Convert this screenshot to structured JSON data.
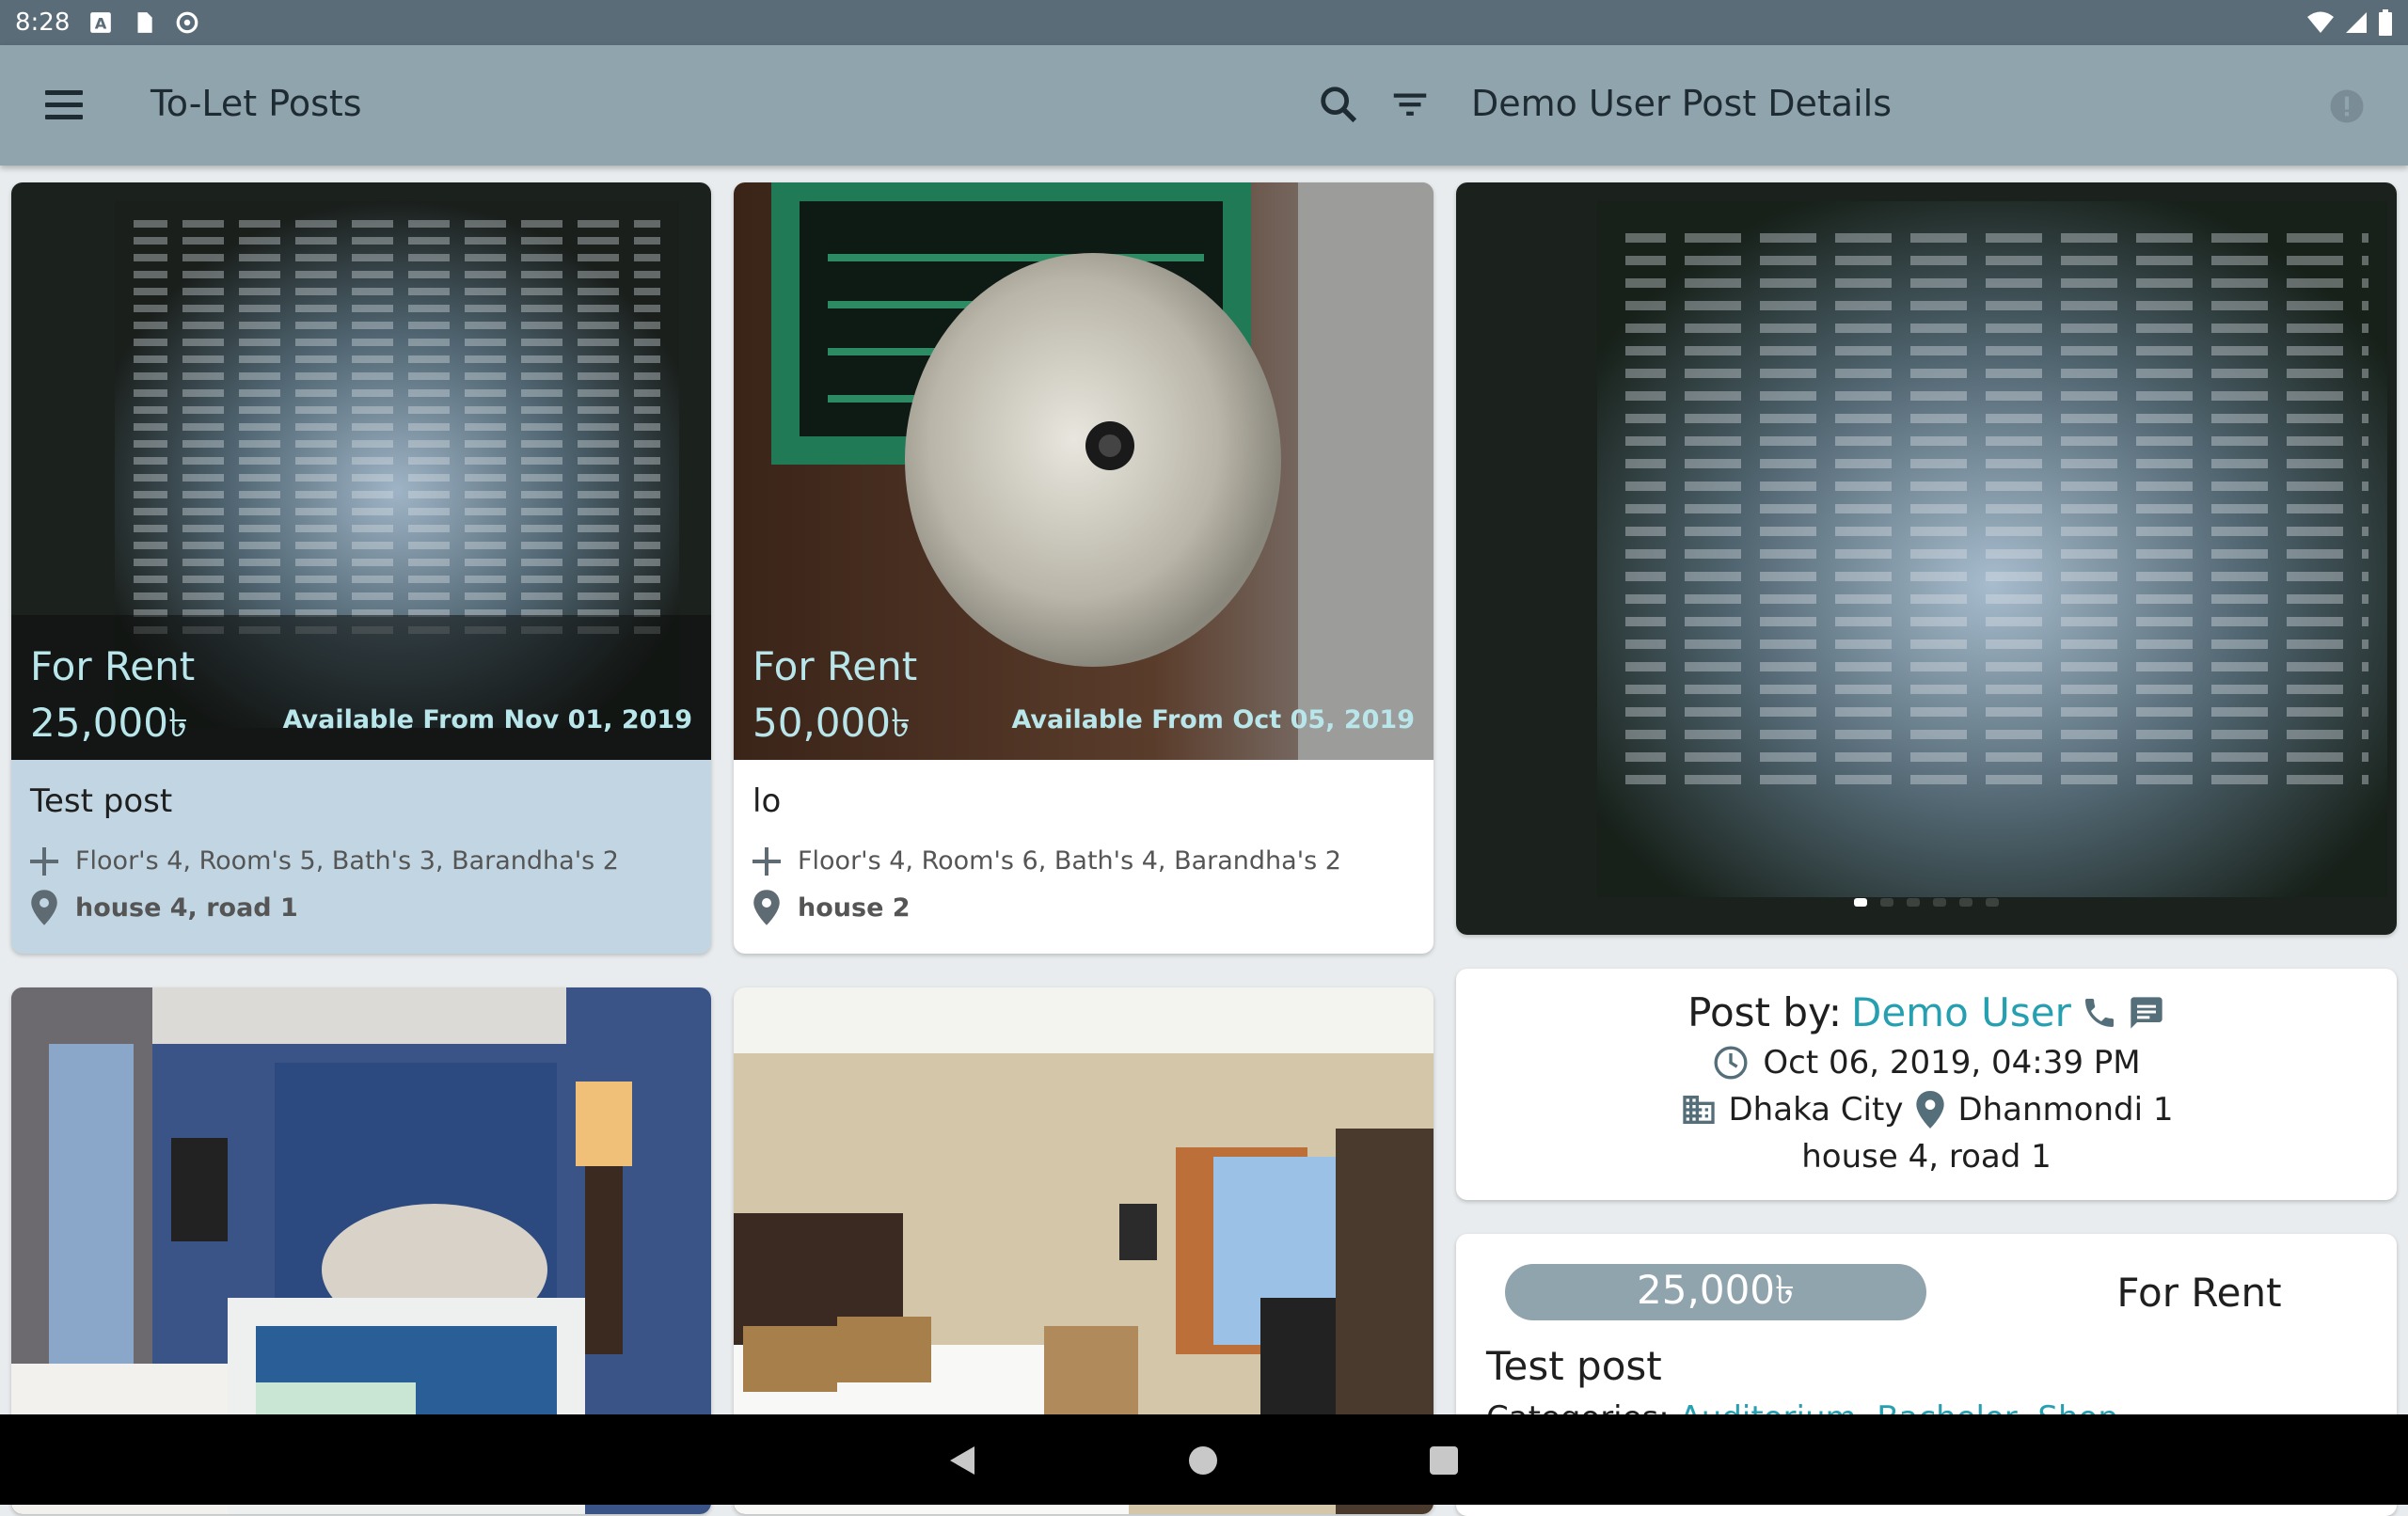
{
  "status_bar": {
    "time": "8:28"
  },
  "app_bar": {
    "title": "To-Let Posts",
    "detail_title": "Demo User Post Details"
  },
  "posts": [
    {
      "status": "For Rent",
      "price": "25,000৳",
      "available": "Available From Nov 01, 2019",
      "title": "Test post",
      "specs": "Floor's 4, Room's 5, Bath's 3, Barandha's 2",
      "address": "house 4, road 1"
    },
    {
      "status": "For Rent",
      "price": "50,000৳",
      "available": "Available From Oct 05, 2019",
      "title": "lo",
      "specs": "Floor's 4, Room's 6, Bath's 4, Barandha's 2",
      "address": "house 2"
    }
  ],
  "detail": {
    "post_by_label": "Post by:",
    "post_by_user": "Demo User",
    "datetime": "Oct 06, 2019, 04:39 PM",
    "city": "Dhaka City",
    "area": "Dhanmondi 1",
    "address": "house 4, road 1",
    "price": "25,000৳",
    "status": "For Rent",
    "title": "Test post",
    "categories_label": "Categories:",
    "categories_values": "Auditorium, Bachelor, Shop"
  },
  "colors": {
    "appbar": "#90a4ae",
    "statusbar": "#5a6c78",
    "accent": "#26a0b0",
    "selected_card": "#c1d6e2"
  },
  "icons": [
    "menu-icon",
    "search-icon",
    "filter-icon",
    "info-icon",
    "plus-icon",
    "location-pin-icon",
    "phone-icon",
    "message-icon",
    "clock-icon",
    "city-icon"
  ]
}
